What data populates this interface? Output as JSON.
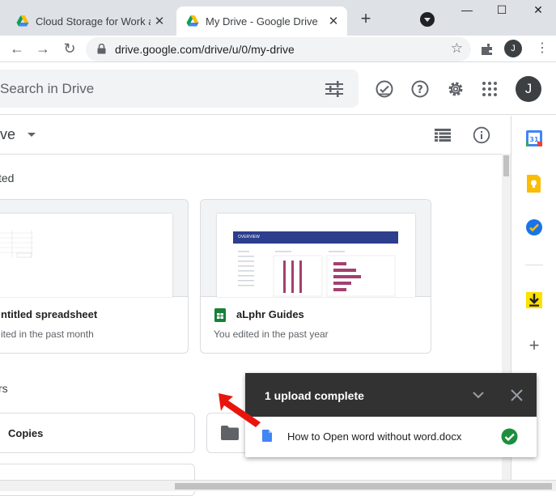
{
  "tabs": [
    {
      "title": "Cloud Storage for Work and",
      "active": false
    },
    {
      "title": "My Drive - Google Drive",
      "active": true
    }
  ],
  "address_bar": {
    "url": "drive.google.com/drive/u/0/my-drive"
  },
  "profile_initial": "J",
  "search": {
    "placeholder": "Search in Drive"
  },
  "breadcrumb": {
    "title": "ive"
  },
  "sections": {
    "suggested": "ted",
    "folders": "rs"
  },
  "suggested_files": [
    {
      "name": "ntitled spreadsheet",
      "meta": "ited in the past month"
    },
    {
      "name": "aLphr Guides",
      "meta": "You edited in the past year",
      "thumb_header": "OVERVIEW"
    }
  ],
  "folders": [
    {
      "name": "Copies"
    }
  ],
  "upload": {
    "title": "1 upload complete",
    "file_name": "How to Open word without word.docx",
    "status": "complete"
  },
  "colors": {
    "toast_bg": "#323232",
    "success": "#1e8e3e",
    "doc_blue": "#4285f4",
    "sheets_green": "#188038",
    "arrow_red": "#e8150c"
  }
}
